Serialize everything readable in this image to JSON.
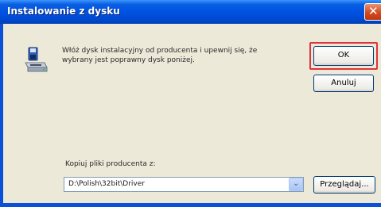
{
  "window": {
    "title": "Instalowanie z dysku",
    "close_glyph": "✕",
    "accent_color": "#0054e3"
  },
  "message": {
    "line1": "Włóż dysk instalacyjny od producenta i upewnij się, że",
    "line2": "wybrany jest poprawny dysk poniżej."
  },
  "buttons": {
    "ok": "OK",
    "cancel": "Anuluj",
    "browse": "Przeglądaj..."
  },
  "copy_from": {
    "label": "Kopiuj pliki producenta z:",
    "path": "D:\\Polish\\32bit\\Driver",
    "dropdown_glyph": "⌄"
  },
  "icons": {
    "dialog_icon": "floppy-disk-drive-icon",
    "focus_highlight_color": "#e0323c"
  }
}
